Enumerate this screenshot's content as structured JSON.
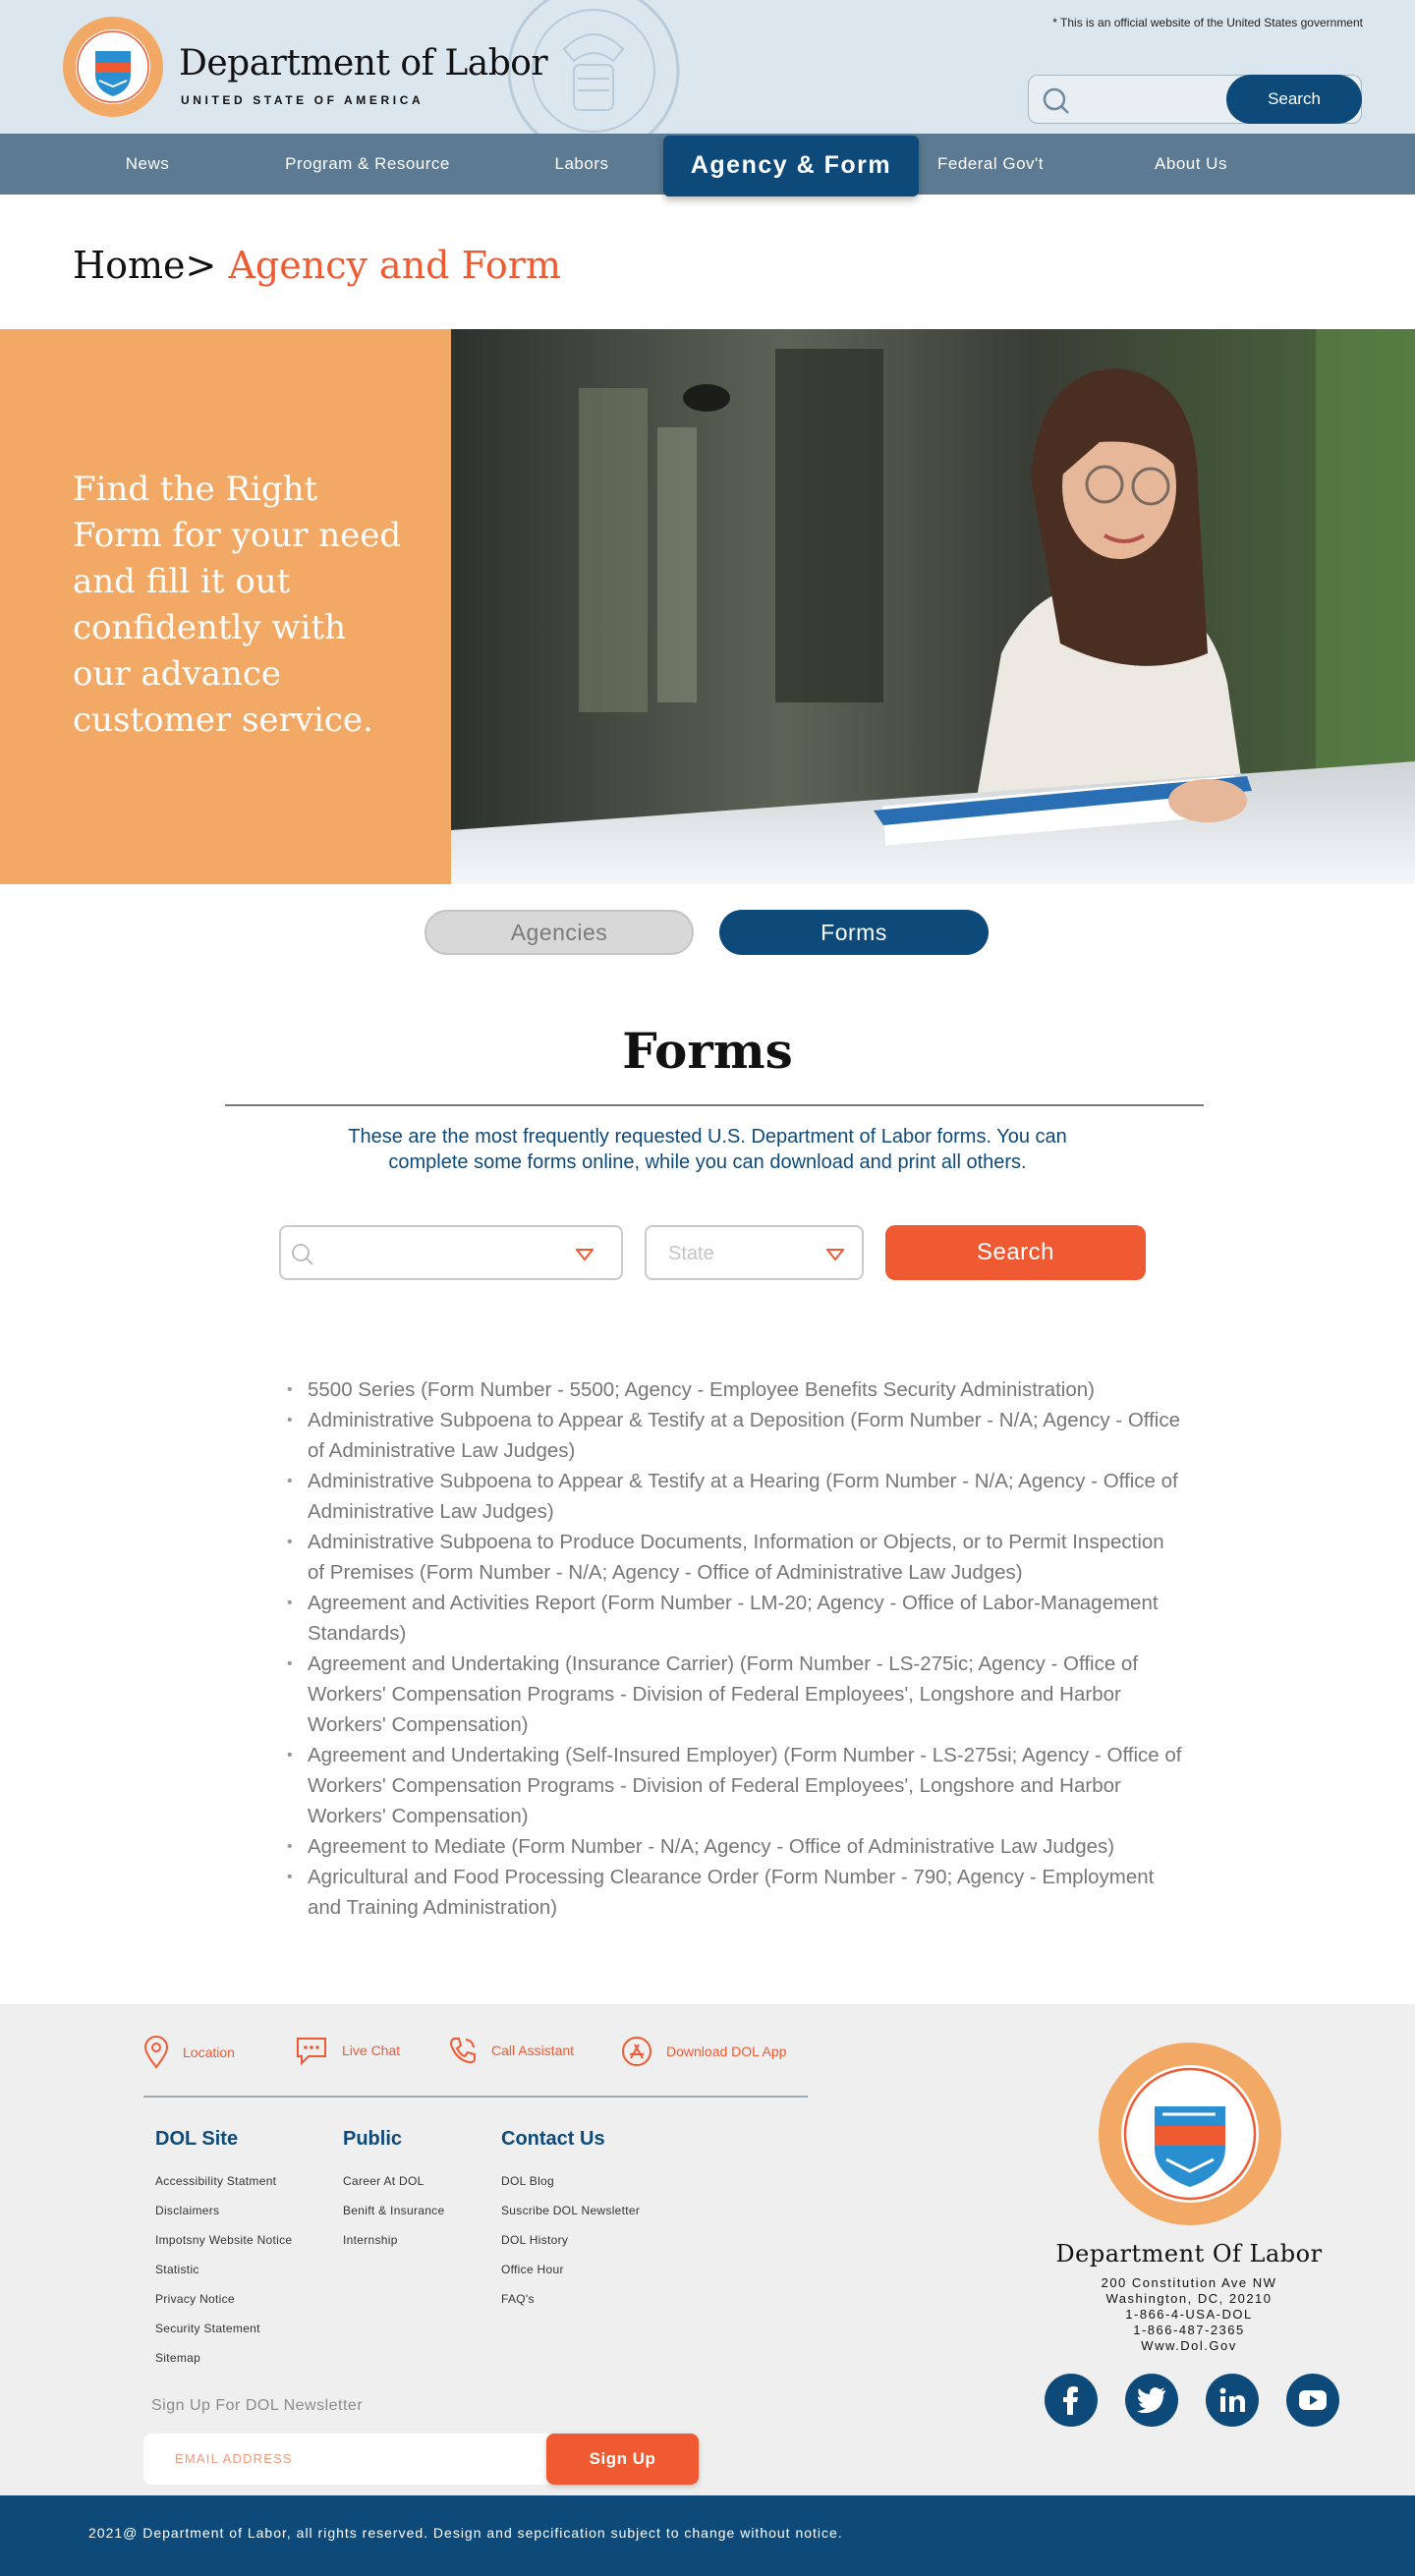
{
  "header": {
    "gov_notice": "* This is an official website of the United States government",
    "brand_title": "Department of Labor",
    "brand_subtitle": "UNITED STATE OF AMERICA",
    "search_button": "Search"
  },
  "nav": {
    "items": [
      {
        "label": "News"
      },
      {
        "label": "Program & Resource"
      },
      {
        "label": "Labors"
      },
      {
        "label": "Agency & Form",
        "active": true
      },
      {
        "label": "Federal Gov't"
      },
      {
        "label": "About Us"
      }
    ]
  },
  "breadcrumb": {
    "home": "Home>",
    "current": "Agency and Form"
  },
  "hero": {
    "text": "Find the Right Form for your need and fill it out confidently with our advance customer service."
  },
  "toggle": {
    "agencies": "Agencies",
    "forms": "Forms"
  },
  "forms_section": {
    "title": "Forms",
    "description": "These are the most frequently requested U.S. Department of Labor forms. You can complete some forms online, while you can download and print all others.",
    "state_placeholder": "State",
    "search_button": "Search",
    "items": [
      "5500 Series (Form Number - 5500; Agency - Employee Benefits Security Administration)",
      "Administrative Subpoena to Appear & Testify at a Deposition (Form Number - N/A; Agency - Office of Administrative Law Judges)",
      "Administrative Subpoena to Appear & Testify at a Hearing (Form Number - N/A; Agency - Office of Administrative Law Judges)",
      "Administrative Subpoena to Produce Documents, Information or Objects, or to Permit Inspection of Premises (Form Number - N/A; Agency - Office of Administrative Law Judges)",
      "Agreement and Activities Report (Form Number - LM-20; Agency - Office of Labor-Management Standards)",
      "Agreement and Undertaking (Insurance Carrier) (Form Number - LS-275ic; Agency - Office of Workers' Compensation Programs - Division of Federal Employees', Longshore and Harbor Workers' Compensation)",
      "Agreement and Undertaking (Self-Insured Employer) (Form Number - LS-275si; Agency - Office of Workers' Compensation Programs - Division of Federal Employees', Longshore and Harbor Workers' Compensation)",
      "Agreement to Mediate (Form Number - N/A; Agency - Office of Administrative Law Judges)",
      "Agricultural and Food Processing Clearance Order (Form Number - 790; Agency - Employment and Training Administration)"
    ]
  },
  "footer": {
    "contact": {
      "location": "Location",
      "live_chat": "Live Chat",
      "call_assistant": "Call Assistant",
      "download_app": "Download DOL App"
    },
    "columns": [
      {
        "heading": "DOL Site",
        "links": [
          "Accessibility Statment",
          "Disclaimers",
          "Impotsny Website Notice",
          "Statistic",
          "Privacy Notice",
          "Security Statement",
          "Sitemap"
        ]
      },
      {
        "heading": "Public",
        "links": [
          "Career At DOL",
          "Benift & Insurance",
          "Internship"
        ]
      },
      {
        "heading": "Contact Us",
        "links": [
          "DOL Blog",
          "Suscribe DOL Newsletter",
          "DOL History",
          "Office Hour",
          "FAQ's"
        ]
      }
    ],
    "newsletter_label": "Sign Up For DOL Newsletter",
    "newsletter_placeholder": "EMAIL ADDRESS",
    "signup_button": "Sign Up",
    "brand": "Department Of Labor",
    "address": [
      "200 Constitution Ave NW",
      "Washington, DC, 20210",
      "1-866-4-USA-DOL",
      "1-866-487-2365",
      "Www.Dol.Gov"
    ],
    "copyright": "2021@ Department of Labor, all rights reserved.  Design and sepcification subject to change without notice."
  },
  "colors": {
    "primary_navy": "#0d4a7a",
    "accent_orange": "#f05a32",
    "hero_peach": "#f2a965",
    "nav_slate": "#5c7a91",
    "header_bg": "#dce6ee"
  },
  "icons": [
    "search-icon",
    "chevron-down-icon",
    "location-pin-icon",
    "chat-bubble-icon",
    "phone-icon",
    "app-store-icon",
    "facebook-icon",
    "twitter-icon",
    "linkedin-icon",
    "youtube-icon"
  ]
}
